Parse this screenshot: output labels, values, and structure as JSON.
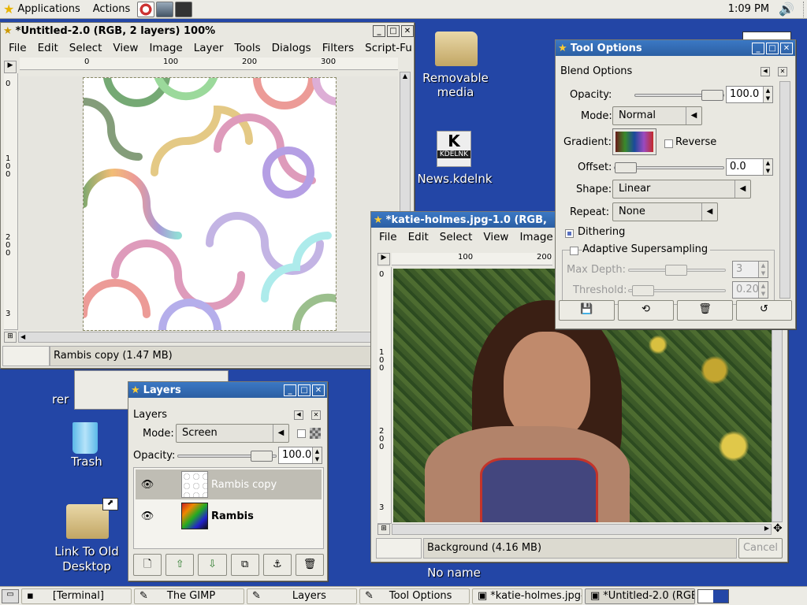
{
  "top_panel": {
    "applications": "Applications",
    "actions": "Actions",
    "clock": "1:09 PM"
  },
  "desktop": {
    "removable": "Removable media",
    "news_badge": "KDELNK",
    "news": "News.kdelnk",
    "trash": "Trash",
    "link_old": "Link To Old Desktop",
    "no_name": "No name",
    "partial_left": "rer"
  },
  "untitled": {
    "title": "*Untitled-2.0 (RGB, 2 layers) 100%",
    "menu": [
      "File",
      "Edit",
      "Select",
      "View",
      "Image",
      "Layer",
      "Tools",
      "Dialogs",
      "Filters",
      "Script-Fu"
    ],
    "hruler": [
      "0",
      "100",
      "200",
      "300"
    ],
    "vruler": [
      "0",
      "100",
      "200",
      "3"
    ],
    "status": "Rambis copy (1.47 MB)"
  },
  "katie": {
    "title": "*katie-holmes.jpg-1.0 (RGB,",
    "menu": [
      "File",
      "Edit",
      "Select",
      "View",
      "Image"
    ],
    "hruler": [
      "100",
      "200"
    ],
    "vruler": [
      "0",
      "100",
      "200",
      "3"
    ],
    "status": "Background (4.16 MB)",
    "cancel": "Cancel"
  },
  "tool_options": {
    "title": "Tool Options",
    "section": "Blend Options",
    "opacity_label": "Opacity:",
    "opacity": "100.0",
    "mode_label": "Mode:",
    "mode": "Normal",
    "gradient_label": "Gradient:",
    "reverse": "Reverse",
    "offset_label": "Offset:",
    "offset": "0.0",
    "shape_label": "Shape:",
    "shape": "Linear",
    "repeat_label": "Repeat:",
    "repeat": "None",
    "dithering": "Dithering",
    "adaptive": "Adaptive Supersampling",
    "maxdepth_label": "Max Depth:",
    "maxdepth": "3",
    "threshold_label": "Threshold:",
    "threshold": "0.20"
  },
  "layers": {
    "title": "Layers",
    "section": "Layers",
    "mode_label": "Mode:",
    "mode": "Screen",
    "opacity_label": "Opacity:",
    "opacity": "100.0",
    "items": [
      {
        "name": "Rambis copy"
      },
      {
        "name": "Rambis"
      }
    ]
  },
  "taskbar": [
    "[Terminal]",
    "The GIMP",
    "Layers",
    "Tool Options",
    "*katie-holmes.jpg-",
    "*Untitled-2.0 (RGB,"
  ],
  "colors": {
    "desktop": "#2346a6",
    "titlebar": "#2c5fa3",
    "panel": "#ecebe5"
  }
}
